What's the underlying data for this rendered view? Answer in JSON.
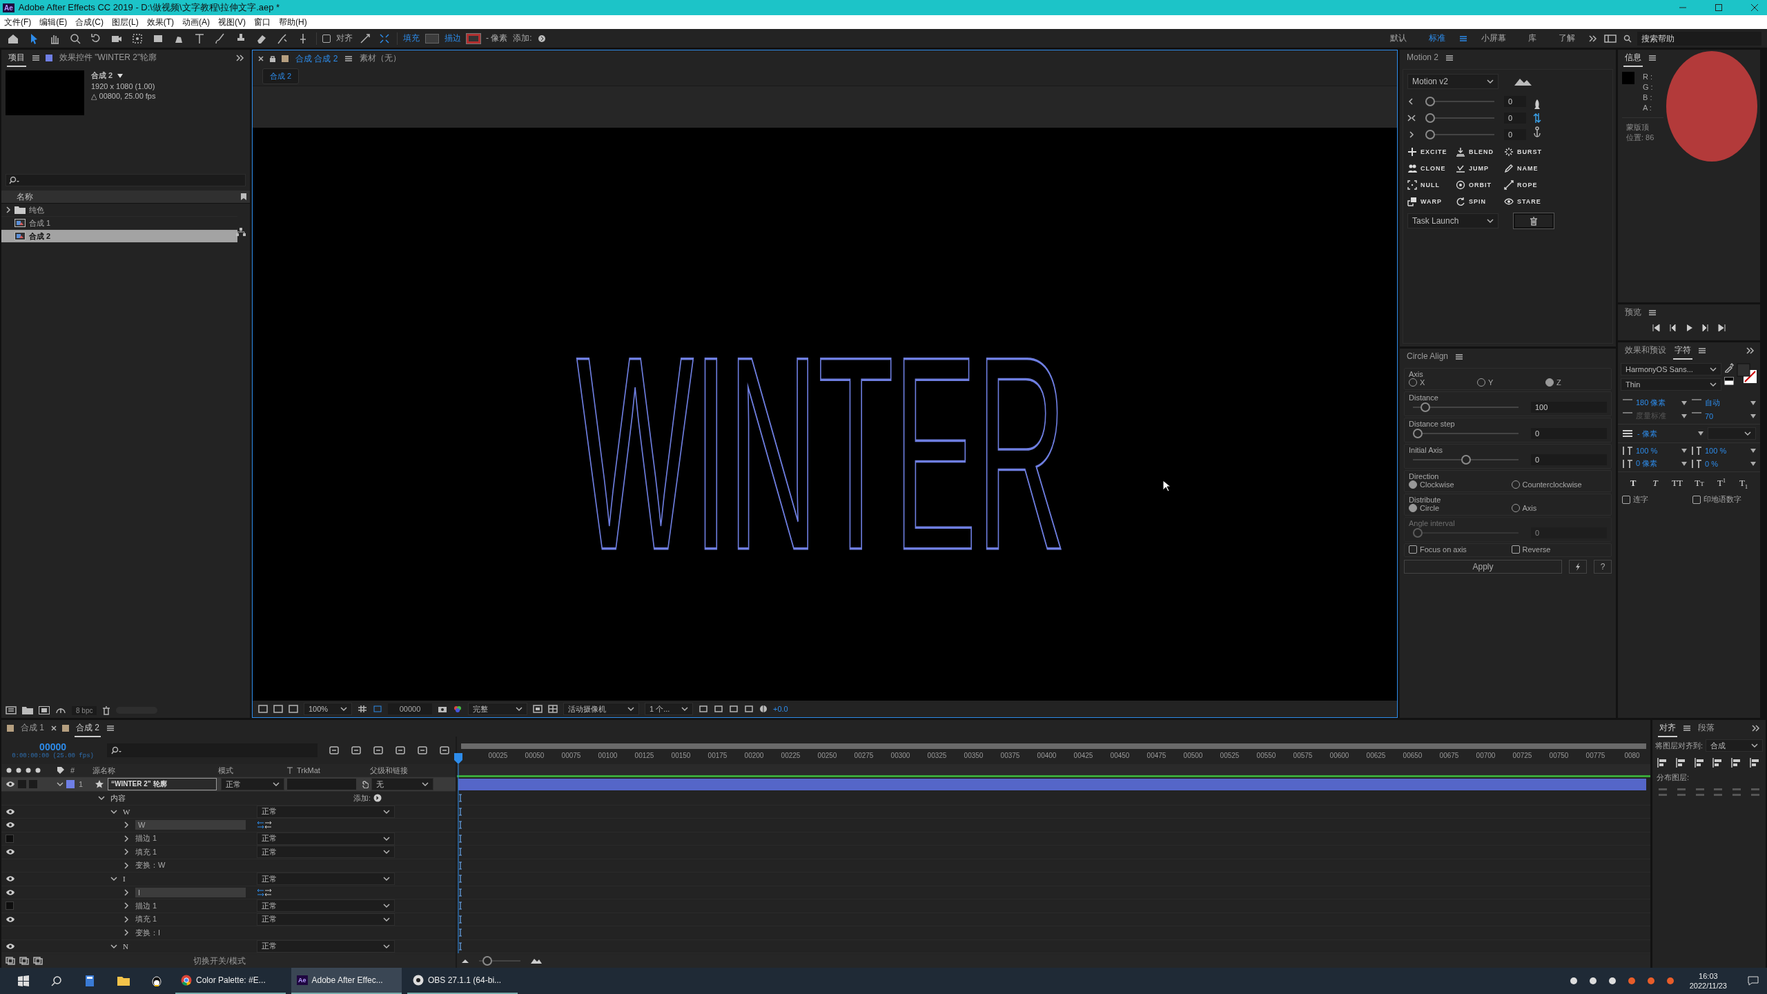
{
  "window": {
    "logo": "Ae",
    "title": "Adobe After Effects CC 2019 - D:\\做视频\\文字教程\\拉伸文字.aep *"
  },
  "menu": [
    "文件(F)",
    "编辑(E)",
    "合成(C)",
    "图层(L)",
    "效果(T)",
    "动画(A)",
    "视图(V)",
    "窗口",
    "帮助(H)"
  ],
  "toolbar": {
    "snap_label": "对齐",
    "snap_checked": false,
    "fill_label": "填充",
    "stroke_label": "描边",
    "stroke_width": "- 像素",
    "add_label": "添加:",
    "workspaces": [
      {
        "label": "默认",
        "selected": false
      },
      {
        "label": "标准",
        "selected": true
      },
      {
        "label": "小屏幕",
        "selected": false
      },
      {
        "label": "库",
        "selected": false
      },
      {
        "label": "了解",
        "selected": false
      }
    ],
    "search": {
      "placeholder": "搜索帮助"
    }
  },
  "project_panel": {
    "tabs": [
      {
        "label": "项目",
        "selected": true
      },
      {
        "label": "效果控件 \"WINTER 2\"轮廓",
        "selected": false
      }
    ],
    "comp_name": "合成 2",
    "comp_size": "1920 x 1080 (1.00)",
    "comp_duration": "△ 00800, 25.00 fps",
    "column": "名称",
    "items": [
      {
        "kind": "folder",
        "name": "纯色",
        "selected": false
      },
      {
        "kind": "comp",
        "name": "合成 1",
        "selected": false
      },
      {
        "kind": "comp",
        "name": "合成 2",
        "selected": true
      }
    ],
    "bit_depth": "8 bpc"
  },
  "viewer": {
    "tabs": [
      {
        "label": "合成 合成 2",
        "selected": true
      },
      {
        "label": "素材（无）",
        "selected": false
      }
    ],
    "subtab": "合成 2",
    "artwork_text": "WINTER",
    "zoom": "100%",
    "timecode": "00000",
    "resolution": "完整",
    "camera": "活动摄像机",
    "views": "1 个...",
    "exposure": "+0.0"
  },
  "motion_panel": {
    "title": "Motion 2",
    "preset": "Motion v2",
    "sliders": [
      {
        "level": 0,
        "value": "0"
      },
      {
        "level": 0,
        "value": "0"
      },
      {
        "level": 0,
        "value": "0"
      }
    ],
    "actions": [
      "EXCITE",
      "BLEND",
      "BURST",
      "CLONE",
      "JUMP",
      "NAME",
      "NULL",
      "ORBIT",
      "ROPE",
      "WARP",
      "SPIN",
      "STARE"
    ],
    "task": "Task Launch"
  },
  "circle_align": {
    "title": "Circle Align",
    "groups": [
      {
        "kind": "radio",
        "label": "Axis",
        "options": [
          {
            "label": "X",
            "selected": false
          },
          {
            "label": "Y",
            "selected": false
          },
          {
            "label": "Z",
            "selected": true
          }
        ]
      },
      {
        "kind": "slider",
        "label": "Distance",
        "level": 0.08,
        "value": "100",
        "disabled": false
      },
      {
        "kind": "slider",
        "label": "Distance step",
        "level": 0,
        "value": "0",
        "disabled": false
      },
      {
        "kind": "slider",
        "label": "Initial Axis",
        "level": 0.5,
        "value": "0",
        "disabled": false
      },
      {
        "kind": "radio",
        "label": "Direction",
        "options": [
          {
            "label": "Clockwise",
            "selected": true
          },
          {
            "label": "Counterclockwise",
            "selected": false
          }
        ]
      },
      {
        "kind": "radio",
        "label": "Distribute",
        "options": [
          {
            "label": "Circle",
            "selected": true
          },
          {
            "label": "Axis",
            "selected": false
          }
        ]
      },
      {
        "kind": "slider",
        "label": "Angle interval",
        "level": 0,
        "value": "0",
        "disabled": true
      },
      {
        "kind": "checks",
        "options": [
          {
            "label": "Focus on axis",
            "checked": false
          },
          {
            "label": "Reverse",
            "checked": false
          }
        ]
      }
    ],
    "apply": "Apply",
    "help": "?"
  },
  "info_panel": {
    "tab": "信息",
    "channels": [
      "R :",
      "G :",
      "B :",
      "A :"
    ],
    "lines": [
      "蒙版顶",
      "位置: 86"
    ]
  },
  "preview_panel": {
    "title": "预览"
  },
  "character_panel": {
    "tabs": [
      {
        "label": "效果和预设",
        "selected": false
      },
      {
        "label": "字符",
        "selected": true
      }
    ],
    "font": "HarmonyOS Sans...",
    "style": "Thin",
    "metrics": [
      {
        "value": "180 像素",
        "disabled": false
      },
      {
        "value": "自动",
        "disabled": false
      },
      {
        "value": "度量标准",
        "disabled": true
      },
      {
        "value": "70",
        "disabled": false
      }
    ],
    "stroke": "- 像素",
    "scales": [
      {
        "value": "100 %",
        "disabled": false
      },
      {
        "value": "100 %",
        "disabled": false
      },
      {
        "value": "0 像素",
        "disabled": false
      },
      {
        "value": "0 %",
        "disabled": false
      }
    ],
    "styles": [
      {
        "kind": "bold",
        "label": "T"
      },
      {
        "kind": "italic",
        "label": "T"
      },
      {
        "kind": "caps",
        "label": "TT"
      },
      {
        "kind": "smallcaps",
        "label": "Tт"
      },
      {
        "kind": "super",
        "label": "T$^{1}$"
      },
      {
        "kind": "sub",
        "label": "T$_{1}$"
      }
    ],
    "options": [
      {
        "label": "连字",
        "checked": false
      },
      {
        "label": "印地语数字",
        "checked": false
      }
    ]
  },
  "align_panel": {
    "tabs": [
      {
        "label": "对齐",
        "selected": true
      },
      {
        "label": "段落",
        "selected": false
      }
    ],
    "target_label": "将图层对齐到:",
    "target": "合成",
    "distribute_label": "分布图层:"
  },
  "timeline": {
    "tabs": [
      {
        "label": "合成 1",
        "selected": false
      },
      {
        "label": "合成 2",
        "selected": true
      }
    ],
    "timecode": "00000",
    "timecode_detail": "0:00:00:00 (25.00 fps)",
    "ruler": [
      "00025",
      "00050",
      "00075",
      "00100",
      "00125",
      "00150",
      "00175",
      "00200",
      "00225",
      "00250",
      "00275",
      "00300",
      "00325",
      "00350",
      "00375",
      "00400",
      "00425",
      "00450",
      "00475",
      "00500",
      "00525",
      "00550",
      "00575",
      "00600",
      "00625",
      "00650",
      "00675",
      "00700",
      "00725",
      "00750",
      "00775",
      "0080"
    ],
    "columns": {
      "index": "#",
      "name": "源名称",
      "mode": "模式",
      "trkmat": "TrkMat",
      "parent": "父级和链接"
    },
    "layer": {
      "index": "1",
      "name": "“WINTER 2” 轮廓",
      "mode": "正常",
      "parent": "无",
      "selected": true
    },
    "rows": [
      {
        "kind": "group",
        "label": "内容",
        "add": "添加:",
        "expanded": true,
        "children": [
          {
            "kind": "group",
            "label": "W",
            "mode": "正常",
            "visible": true,
            "expanded": true,
            "children": [
              {
                "kind": "path",
                "label": "W",
                "visible": true,
                "expanded": false
              },
              {
                "kind": "prop",
                "label": "描边 1",
                "mode": "正常",
                "visible": false,
                "expanded": false
              },
              {
                "kind": "prop",
                "label": "填充 1",
                "mode": "正常",
                "visible": true,
                "expanded": false
              },
              {
                "kind": "prop",
                "label": "变换：W",
                "expanded": false
              }
            ]
          },
          {
            "kind": "group",
            "label": "I",
            "mode": "正常",
            "visible": true,
            "expanded": true,
            "children": [
              {
                "kind": "path",
                "label": "I",
                "visible": true,
                "expanded": false
              },
              {
                "kind": "prop",
                "label": "描边 1",
                "mode": "正常",
                "visible": false,
                "expanded": false
              },
              {
                "kind": "prop",
                "label": "填充 1",
                "mode": "正常",
                "visible": true,
                "expanded": false
              },
              {
                "kind": "prop",
                "label": "变换：I",
                "expanded": false
              }
            ]
          },
          {
            "kind": "group",
            "label": "N",
            "mode": "正常",
            "visible": true,
            "expanded": true
          }
        ]
      }
    ],
    "footer": "切换开关/模式",
    "zoom_slider": {
      "level": 0.1
    }
  },
  "taskbar": {
    "apps": [
      {
        "label": "Color Palette: #E...",
        "active": false
      },
      {
        "label": "Adobe After Effec...",
        "active": true
      },
      {
        "label": "OBS 27.1.1 (64-bi...",
        "active": false
      }
    ],
    "ae_logo": "Ae",
    "time": "16:03",
    "date": "2022/11/23"
  }
}
